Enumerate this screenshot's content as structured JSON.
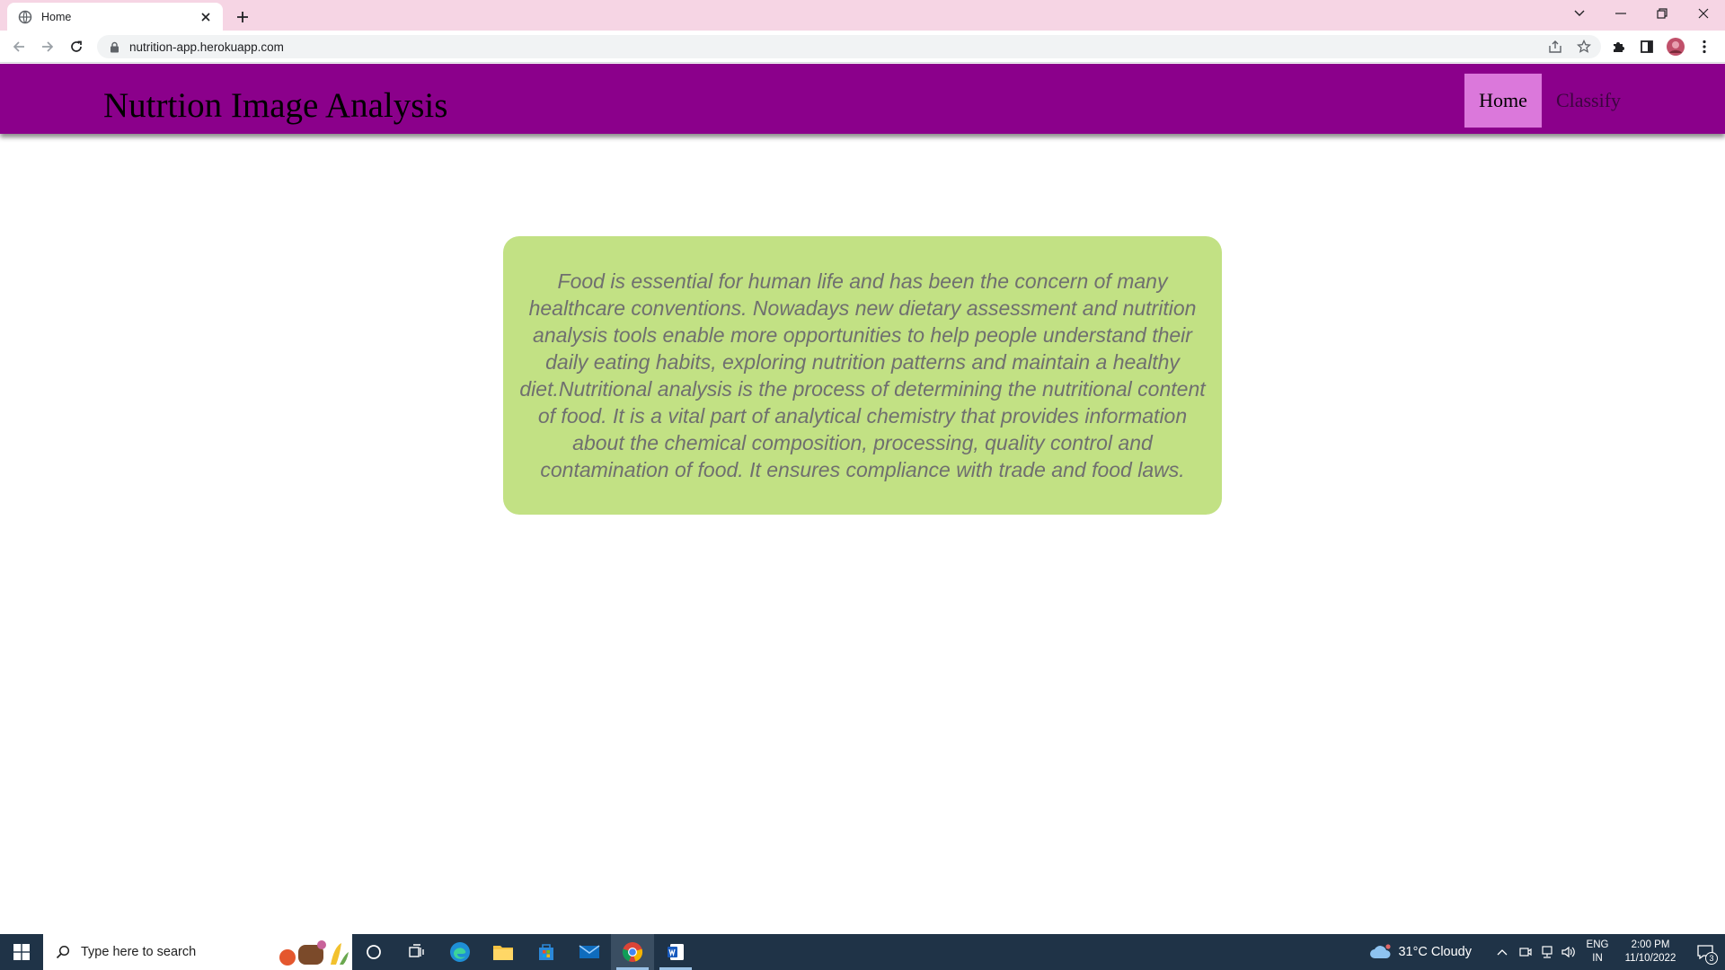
{
  "browser": {
    "tab_title": "Home",
    "url": "nutrition-app.herokuapp.com",
    "icons": {
      "favicon": "globe-icon",
      "close": "close-icon",
      "new_tab": "plus-icon",
      "back": "back-arrow-icon",
      "forward": "forward-arrow-icon",
      "reload": "reload-icon",
      "lock": "lock-icon",
      "share": "share-icon",
      "bookmark": "star-icon",
      "extensions": "puzzle-icon",
      "side_panel": "side-panel-icon",
      "profile": "avatar-icon",
      "menu": "kebab-menu-icon"
    }
  },
  "page": {
    "brand": "Nutrtion Image Analysis",
    "nav": [
      {
        "label": "Home",
        "active": true
      },
      {
        "label": "Classify",
        "active": false
      }
    ],
    "intro": "Food is essential for human life and has been the concern of many healthcare conventions. Nowadays new dietary assessment and nutrition analysis tools enable more opportunities to help people understand their daily eating habits, exploring nutrition patterns and maintain a healthy diet.Nutritional analysis is the process of determining the nutritional content of food. It is a vital part of analytical chemistry that provides information about the chemical composition, processing, quality control and contamination of food. It ensures compliance with trade and food laws.",
    "colors": {
      "navbar": "#8b008b",
      "nav_active": "#db78db",
      "card": "#c2e184",
      "card_text": "#6f6f6f"
    }
  },
  "taskbar": {
    "search_placeholder": "Type here to search",
    "weather": "31°C  Cloudy",
    "language": "ENG",
    "region": "IN",
    "time": "2:00 PM",
    "date": "11/10/2022",
    "notifications": "3"
  }
}
